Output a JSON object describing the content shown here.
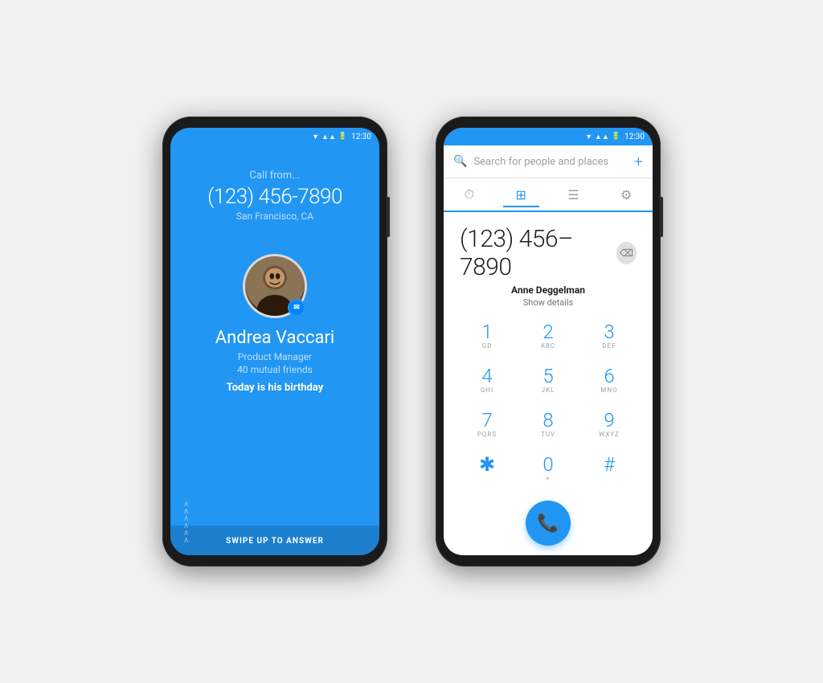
{
  "leftPhone": {
    "statusBar": {
      "time": "12:30"
    },
    "callFrom": "Call from...",
    "phoneNumber": "(123) 456-7890",
    "location": "San Francisco, CA",
    "callerName": "Andrea Vaccari",
    "callerTitle": "Product Manager",
    "mutualFriends": "40 mutual friends",
    "birthday": "Today is his birthday",
    "swipeLabel": "SWIPE UP TO ANSWER"
  },
  "rightPhone": {
    "statusBar": {
      "time": "12:30"
    },
    "search": {
      "placeholder": "Search for people and places",
      "addLabel": "+"
    },
    "tabs": [
      {
        "id": "recents",
        "icon": "⏱",
        "active": false
      },
      {
        "id": "dialpad",
        "icon": "⠿",
        "active": true
      },
      {
        "id": "contacts",
        "icon": "☰",
        "active": false
      },
      {
        "id": "settings",
        "icon": "⚙",
        "active": false
      }
    ],
    "phoneNumber": "(123) 456–7890",
    "contactName": "Anne Deggelman",
    "showDetails": "Show details",
    "keypad": [
      {
        "number": "1",
        "letters": "GD"
      },
      {
        "number": "2",
        "letters": "ABC"
      },
      {
        "number": "3",
        "letters": "DEF"
      },
      {
        "number": "4",
        "letters": "GHI"
      },
      {
        "number": "5",
        "letters": "JKL"
      },
      {
        "number": "6",
        "letters": "MNO"
      },
      {
        "number": "7",
        "letters": "PQRS"
      },
      {
        "number": "8",
        "letters": "TUV"
      },
      {
        "number": "9",
        "letters": "WXYZ"
      },
      {
        "number": "✱",
        "letters": ""
      },
      {
        "number": "0",
        "letters": "+"
      },
      {
        "number": "#",
        "letters": ""
      }
    ]
  }
}
